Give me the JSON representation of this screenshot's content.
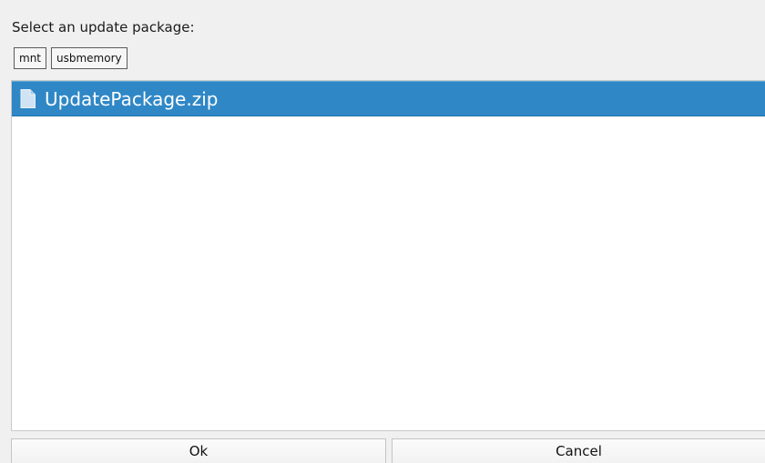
{
  "dialog": {
    "prompt": "Select an update package:"
  },
  "breadcrumb": {
    "items": [
      {
        "label": "mnt"
      },
      {
        "label": "usbmemory"
      }
    ]
  },
  "file_list": {
    "items": [
      {
        "name": "UpdatePackage.zip",
        "icon": "file-icon",
        "selected": true
      }
    ]
  },
  "buttons": {
    "ok_label": "Ok",
    "cancel_label": "Cancel"
  },
  "colors": {
    "selection": "#2f87c6",
    "window_background": "#f0f0f0",
    "list_background": "#ffffff"
  }
}
